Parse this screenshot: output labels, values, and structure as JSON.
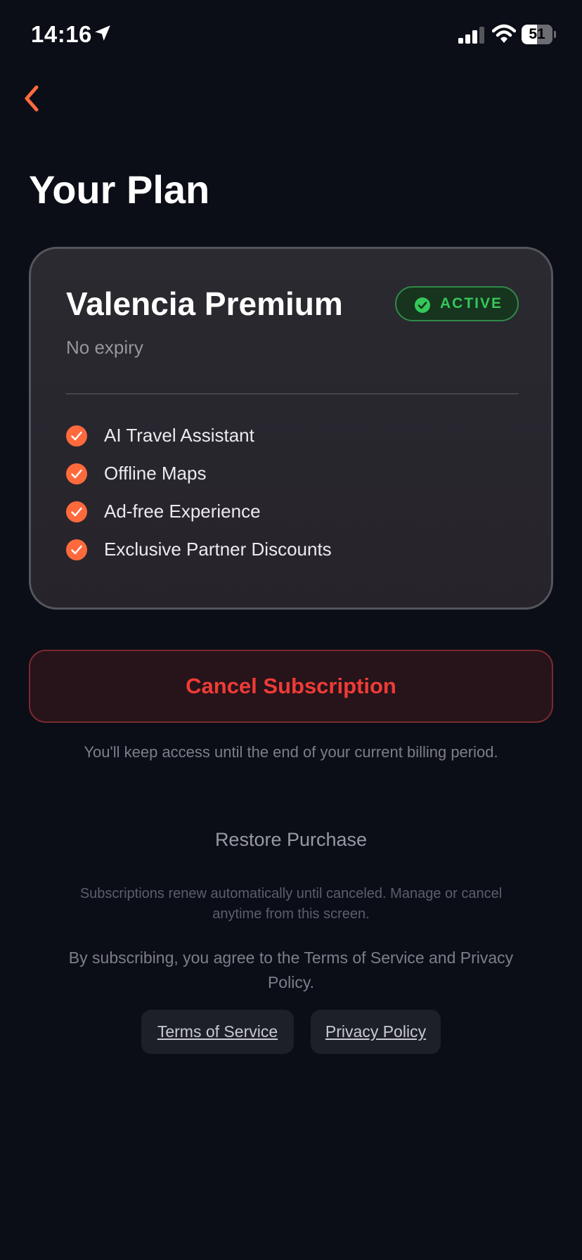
{
  "status_bar": {
    "time": "14:16",
    "battery_level": "51",
    "icons": [
      "location-arrow-icon",
      "cellular-signal-icon",
      "wifi-icon",
      "battery-icon"
    ]
  },
  "header": {
    "back_icon": "chevron-left-icon",
    "title": "Your Plan"
  },
  "plan": {
    "name": "Valencia Premium",
    "badge": "ACTIVE",
    "expiry": "No expiry",
    "features": [
      "AI Travel Assistant",
      "Offline Maps",
      "Ad-free Experience",
      "Exclusive Partner Discounts"
    ]
  },
  "actions": {
    "cancel_label": "Cancel Subscription",
    "billing_note": "You'll keep access until the end of your current billing period.",
    "restore_label": "Restore Purchase"
  },
  "legal": {
    "renew_note": "Subscriptions renew automatically until canceled. Manage or cancel anytime from this screen.",
    "agree_note": "By subscribing, you agree to the Terms of Service and Privacy Policy.",
    "terms_label": "Terms of Service",
    "privacy_label": "Privacy Policy"
  },
  "colors": {
    "background": "#0b0d17",
    "accent": "#ff6a3d",
    "active_green": "#34c759",
    "danger": "#ef3b36"
  }
}
